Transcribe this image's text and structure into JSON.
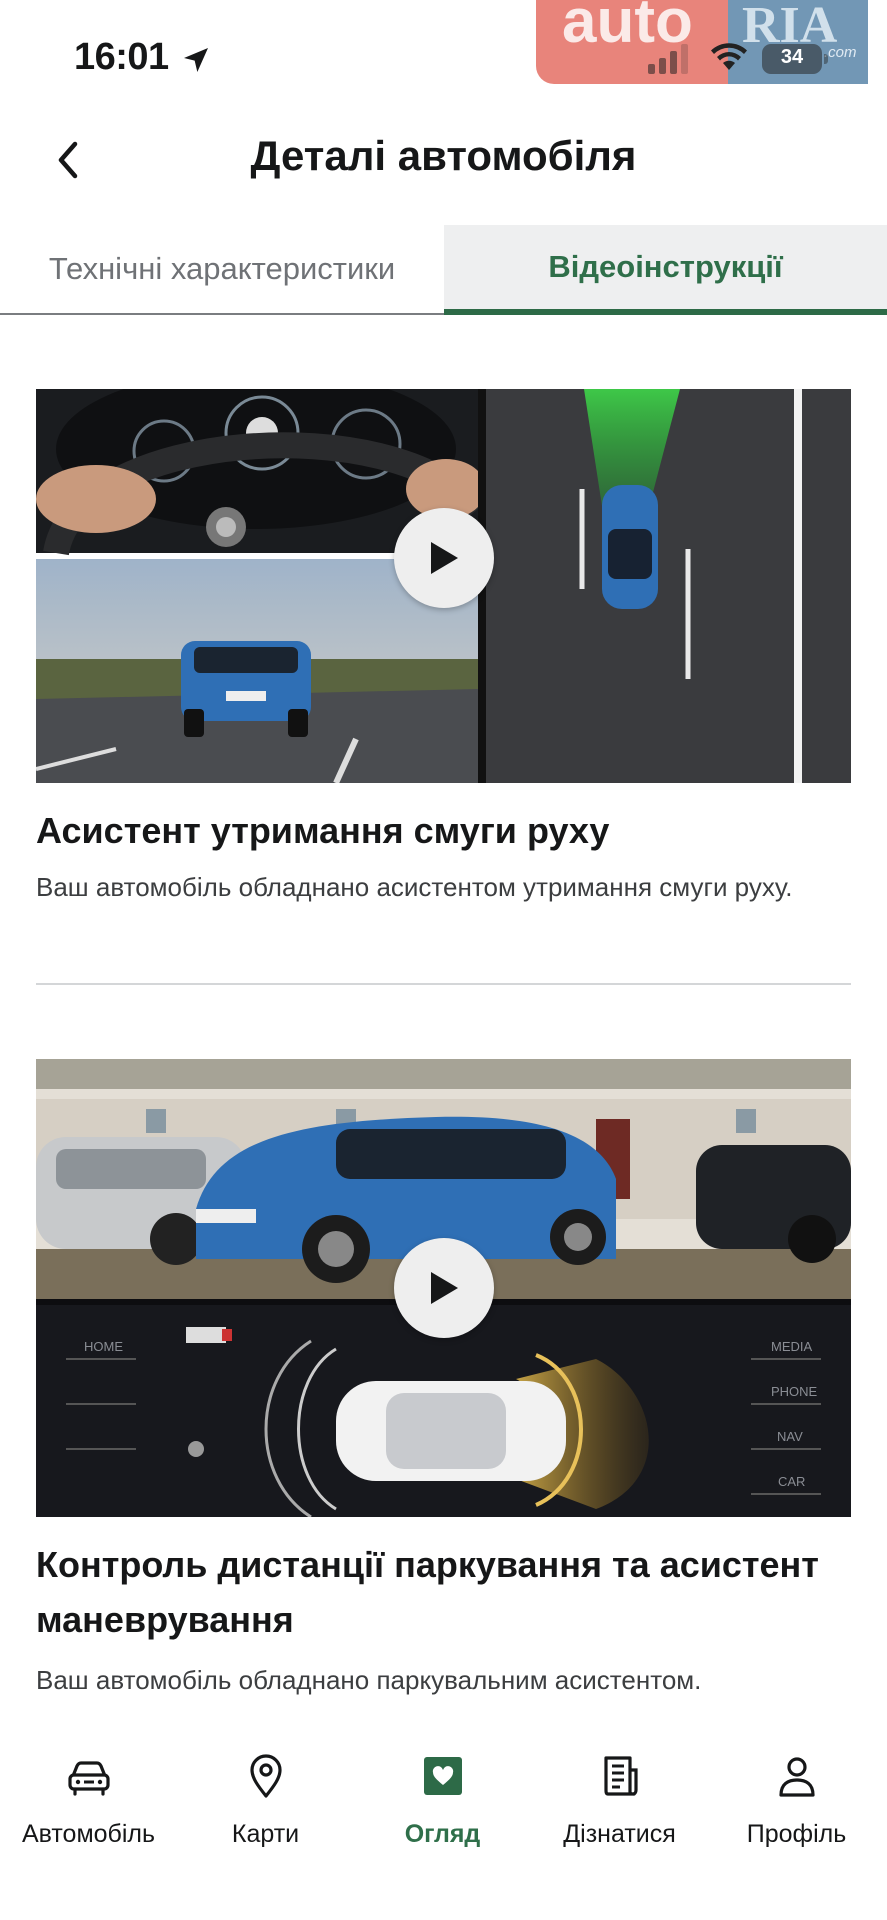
{
  "status_bar": {
    "time": "16:01",
    "battery": "34",
    "watermark_left": "auto",
    "watermark_right": "RIA",
    "watermark_suffix": ".com"
  },
  "header": {
    "title": "Деталі автомобіля",
    "back_icon": "chevron-left-icon"
  },
  "tabs": [
    {
      "label": "Технічні характеристики",
      "active": false
    },
    {
      "label": "Відеоінструкції",
      "active": true
    }
  ],
  "videos": [
    {
      "title": "Асистент утримання смуги руху",
      "description": "Ваш автомобіль обладнано асистентом утримання смуги руху.",
      "thumbnail": "lane-assist-thumbnail"
    },
    {
      "title": "Контроль дистанції паркування та асистент маневрування",
      "description": "Ваш автомобіль обладнано паркувальним асистентом.",
      "thumbnail": "parking-assist-thumbnail",
      "screen_menu_left": [
        "HOME"
      ],
      "screen_menu_right": [
        "MEDIA",
        "PHONE",
        "NAV",
        "CAR"
      ]
    }
  ],
  "bottom_nav": [
    {
      "label": "Автомобіль",
      "icon": "car-icon",
      "active": false
    },
    {
      "label": "Карти",
      "icon": "map-pin-icon",
      "active": false
    },
    {
      "label": "Огляд",
      "icon": "heart-box-icon",
      "active": true
    },
    {
      "label": "Дізнатися",
      "icon": "document-icon",
      "active": false
    },
    {
      "label": "Профіль",
      "icon": "user-icon",
      "active": false
    }
  ],
  "colors": {
    "accent_green": "#2d6a47",
    "text": "#161718",
    "muted_text": "#6f7276"
  }
}
